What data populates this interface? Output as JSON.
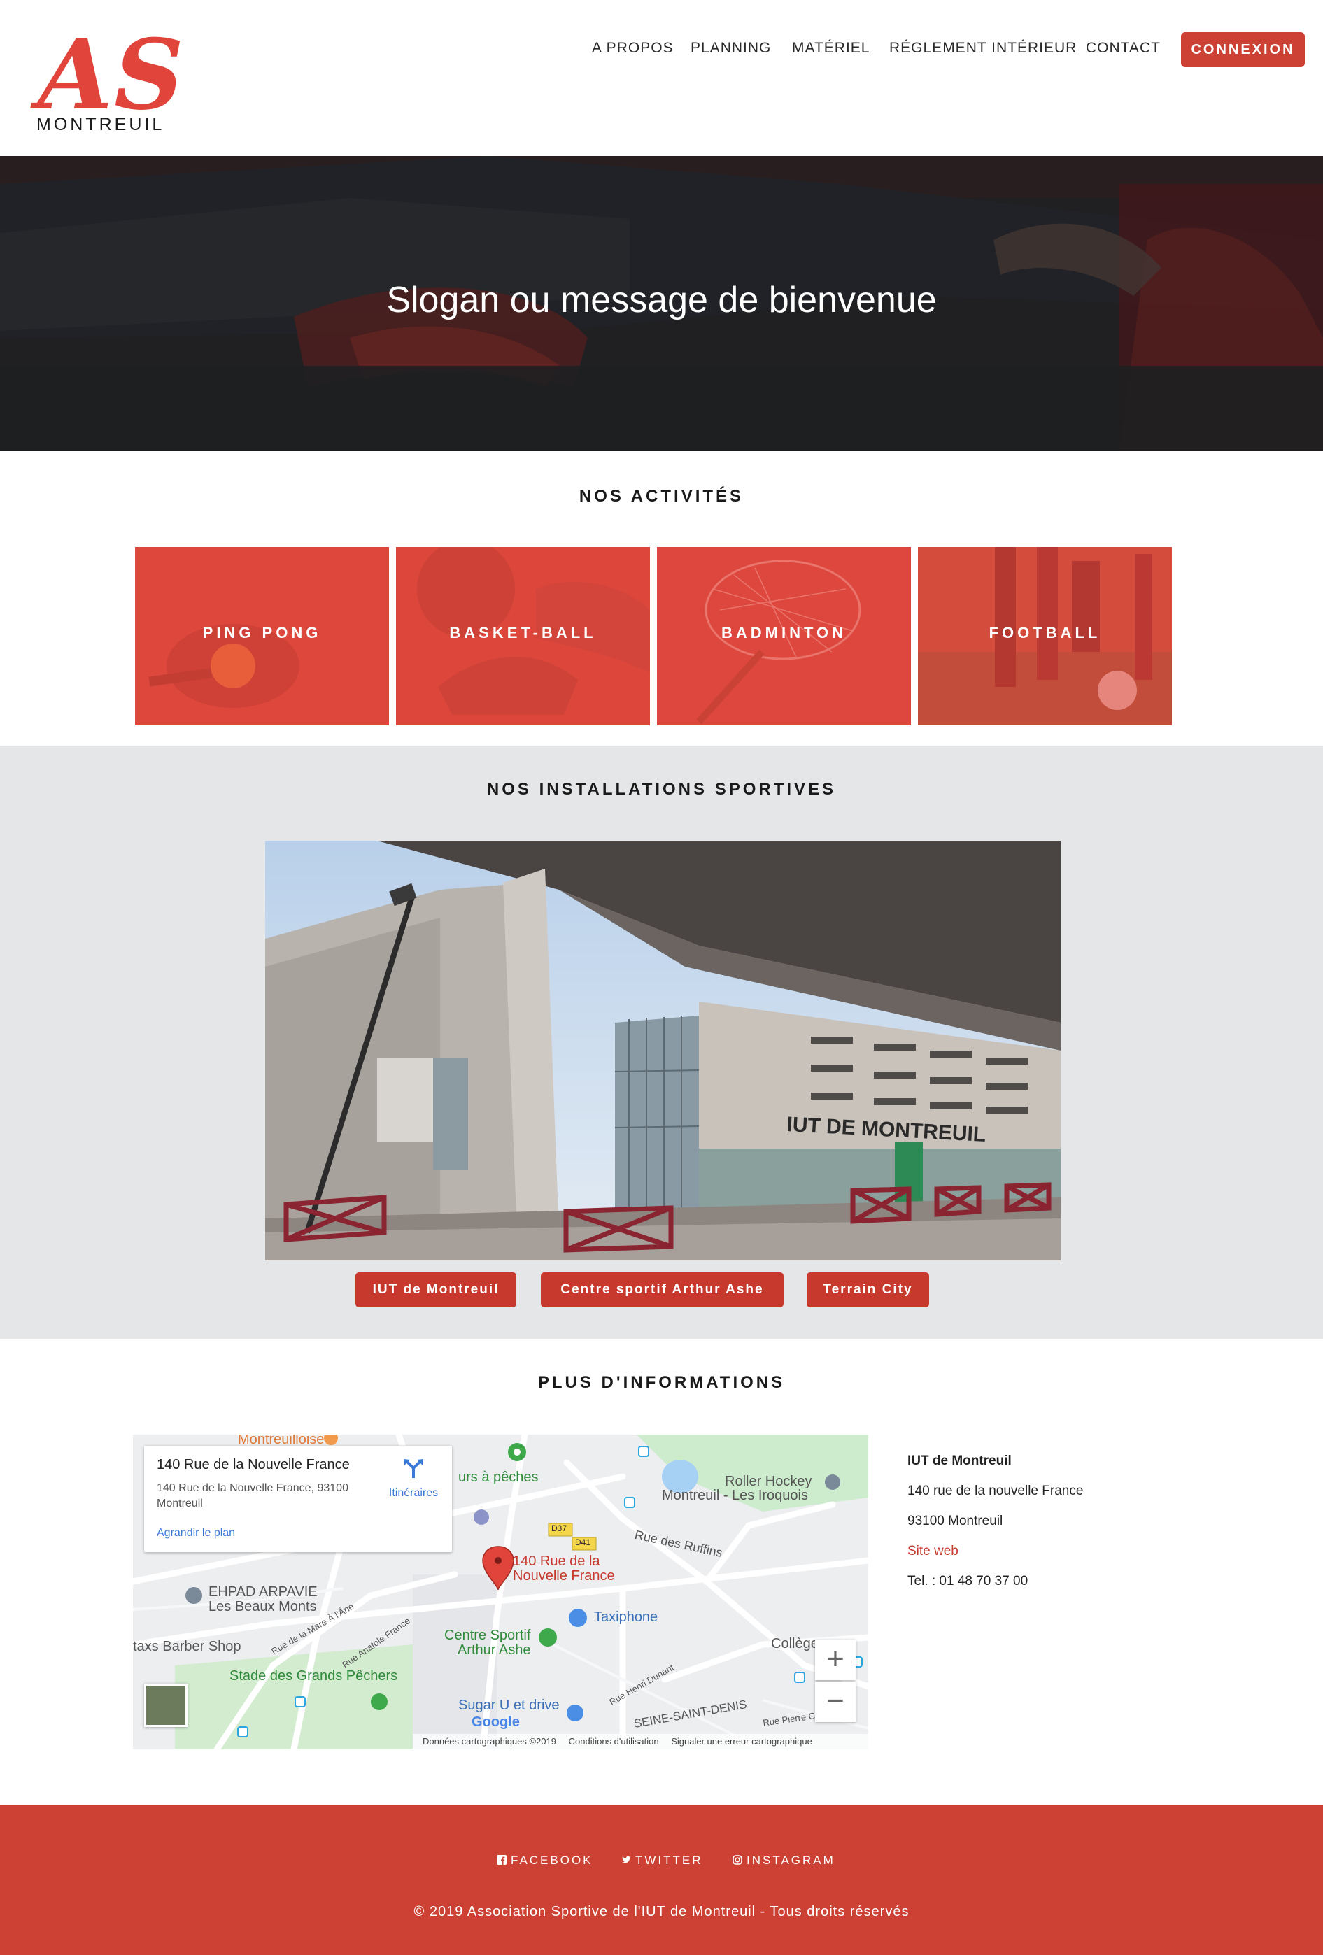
{
  "header": {
    "logo_text": "AS",
    "logo_subtitle": "MONTREUIL",
    "nav": [
      "A PROPOS",
      "PLANNING",
      "MATÉRIEL",
      "RÉGLEMENT INTÉRIEUR",
      "CONTACT"
    ],
    "login_label": "CONNEXION"
  },
  "hero": {
    "title": "Slogan ou message de bienvenue"
  },
  "activities": {
    "title": "NOS ACTIVITÉS",
    "items": [
      "PING PONG",
      "BASKET-BALL",
      "BADMINTON",
      "FOOTBALL"
    ]
  },
  "installations": {
    "title": "NOS INSTALLATIONS SPORTIVES",
    "photo_sign": "IUT DE MONTREUIL",
    "places": [
      "IUT de Montreuil",
      "Centre sportif Arthur Ashe",
      "Terrain City"
    ]
  },
  "info": {
    "title": "PLUS D'INFORMATIONS",
    "map": {
      "card_title": "140 Rue de la Nouvelle France",
      "card_address": "140 Rue de la Nouvelle France, 93100 Montreuil",
      "directions_label": "Itinéraires",
      "enlarge_label": "Agrandir le plan",
      "zoom_in": "+",
      "zoom_out": "−",
      "footer_data": "Données cartographiques ©2019",
      "footer_terms": "Conditions d'utilisation",
      "footer_report": "Signaler une erreur cartographique",
      "google": "Google",
      "labels": {
        "montreuilloise": "Montreuilloise",
        "murs": "urs à pêches",
        "roller": "Roller Hockey",
        "roller2": "Montreuil - Les Iroquois",
        "ruffins": "Rue des Ruffins",
        "pin": "140 Rue de la",
        "pin2": "Nouvelle France",
        "ehpad": "EHPAD ARPAVIE",
        "ehpad2": "Les Beaux Monts",
        "taxiphone": "Taxiphone",
        "barber": "taxs Barber Shop",
        "centre": "Centre Sportif",
        "centre2": "Arthur Ashe",
        "college": "Collège",
        "stade": "Stade des Grands Pêchers",
        "sugar": "Sugar U et drive",
        "seine": "SEINE-SAINT-DENIS",
        "d37": "D37",
        "d41": "D41",
        "rue_mare": "Rue de la Mare À l'Âne",
        "rue_anatole": "Rue Anatole France",
        "rue_henri": "Rue Henri Dunant",
        "rue_pierre": "Rue Pierre Curie"
      }
    },
    "contact": {
      "name": "IUT de Montreuil",
      "street": "140 rue de la nouvelle France",
      "city": "93100 Montreuil",
      "website": "Site web",
      "phone": "Tel. : 01 48 70 37 00"
    }
  },
  "footer": {
    "facebook": "FACEBOOK",
    "twitter": "TWITTER",
    "instagram": "INSTAGRAM",
    "copyright": "© 2019 Association Sportive de l'IUT de Montreuil - Tous droits réservés"
  },
  "colors": {
    "brand_red": "#cc4133",
    "logo_red": "#e0443a",
    "tile_overlay": "#e2473d",
    "link_blue": "#3a79d8",
    "section_gray": "#e5e6e8"
  }
}
